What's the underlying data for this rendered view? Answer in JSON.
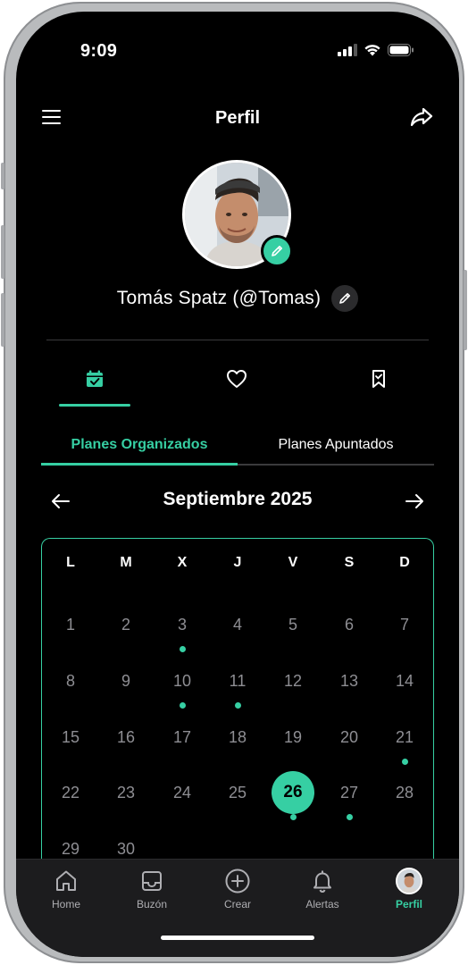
{
  "status_bar": {
    "time": "9:09"
  },
  "header": {
    "title": "Perfil"
  },
  "profile": {
    "name": "Tomás Spatz (@Tomas)"
  },
  "icon_tabs": [
    {
      "icon": "calendar-check-icon",
      "active": true
    },
    {
      "icon": "heart-icon",
      "active": false
    },
    {
      "icon": "bookmark-icon",
      "active": false
    }
  ],
  "text_tabs": [
    {
      "label": "Planes Organizados",
      "active": true
    },
    {
      "label": "Planes Apuntados",
      "active": false
    }
  ],
  "calendar": {
    "month_label": "Septiembre 2025",
    "weekdays": [
      "L",
      "M",
      "X",
      "J",
      "V",
      "S",
      "D"
    ],
    "weeks": [
      [
        "1",
        "2",
        "3",
        "4",
        "5",
        "6",
        "7"
      ],
      [
        "8",
        "9",
        "10",
        "11",
        "12",
        "13",
        "14"
      ],
      [
        "15",
        "16",
        "17",
        "18",
        "19",
        "20",
        "21"
      ],
      [
        "22",
        "23",
        "24",
        "25",
        "26",
        "27",
        "28"
      ],
      [
        "29",
        "30"
      ]
    ],
    "selected_day": "26",
    "days_with_plans": [
      "3",
      "10",
      "11",
      "21",
      "26",
      "27"
    ],
    "accent_color": "#36cfa3"
  },
  "bottom_nav": [
    {
      "label": "Home",
      "icon": "home-icon",
      "active": false
    },
    {
      "label": "Buzón",
      "icon": "inbox-icon",
      "active": false
    },
    {
      "label": "Crear",
      "icon": "plus-circle-icon",
      "active": false
    },
    {
      "label": "Alertas",
      "icon": "bell-icon",
      "active": false
    },
    {
      "label": "Perfil",
      "icon": "avatar-icon",
      "active": true
    }
  ]
}
